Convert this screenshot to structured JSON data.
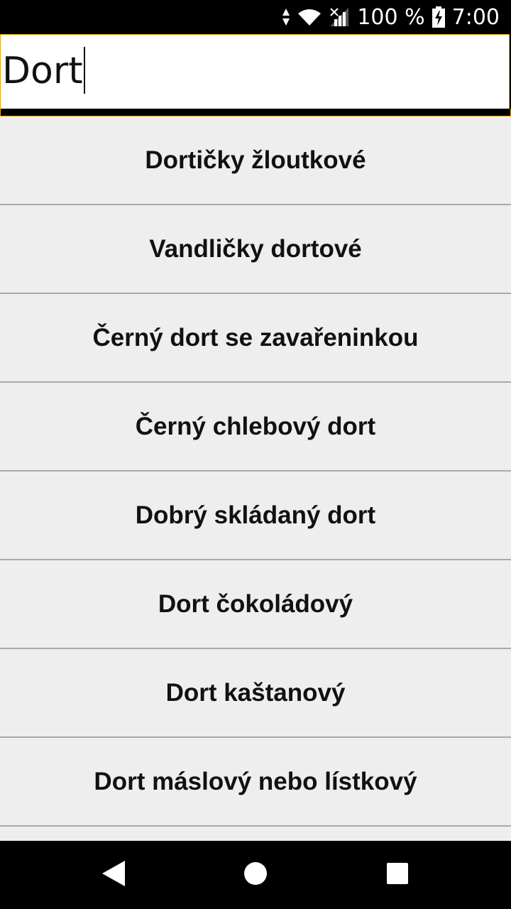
{
  "status_bar": {
    "battery_text": "100 %",
    "time": "7:00",
    "icons": [
      "data-arrows-icon",
      "wifi-icon",
      "signal-icon",
      "battery-charging-icon"
    ]
  },
  "search": {
    "value": "Dort"
  },
  "results": [
    "Dortičky žloutkové",
    "Vandličky dortové",
    "Černý dort se zavařeninkou",
    "Černý chlebový dort",
    "Dobrý skládaný dort",
    "Dort čokoládový",
    "Dort kaštanový",
    "Dort máslový nebo lístkový"
  ],
  "nav_bar": {
    "icons": [
      "back-icon",
      "home-icon",
      "recents-icon"
    ]
  },
  "colors": {
    "focus_border": "#e0a80f",
    "list_background": "#eeeeee",
    "divider": "#a8a8a8"
  }
}
